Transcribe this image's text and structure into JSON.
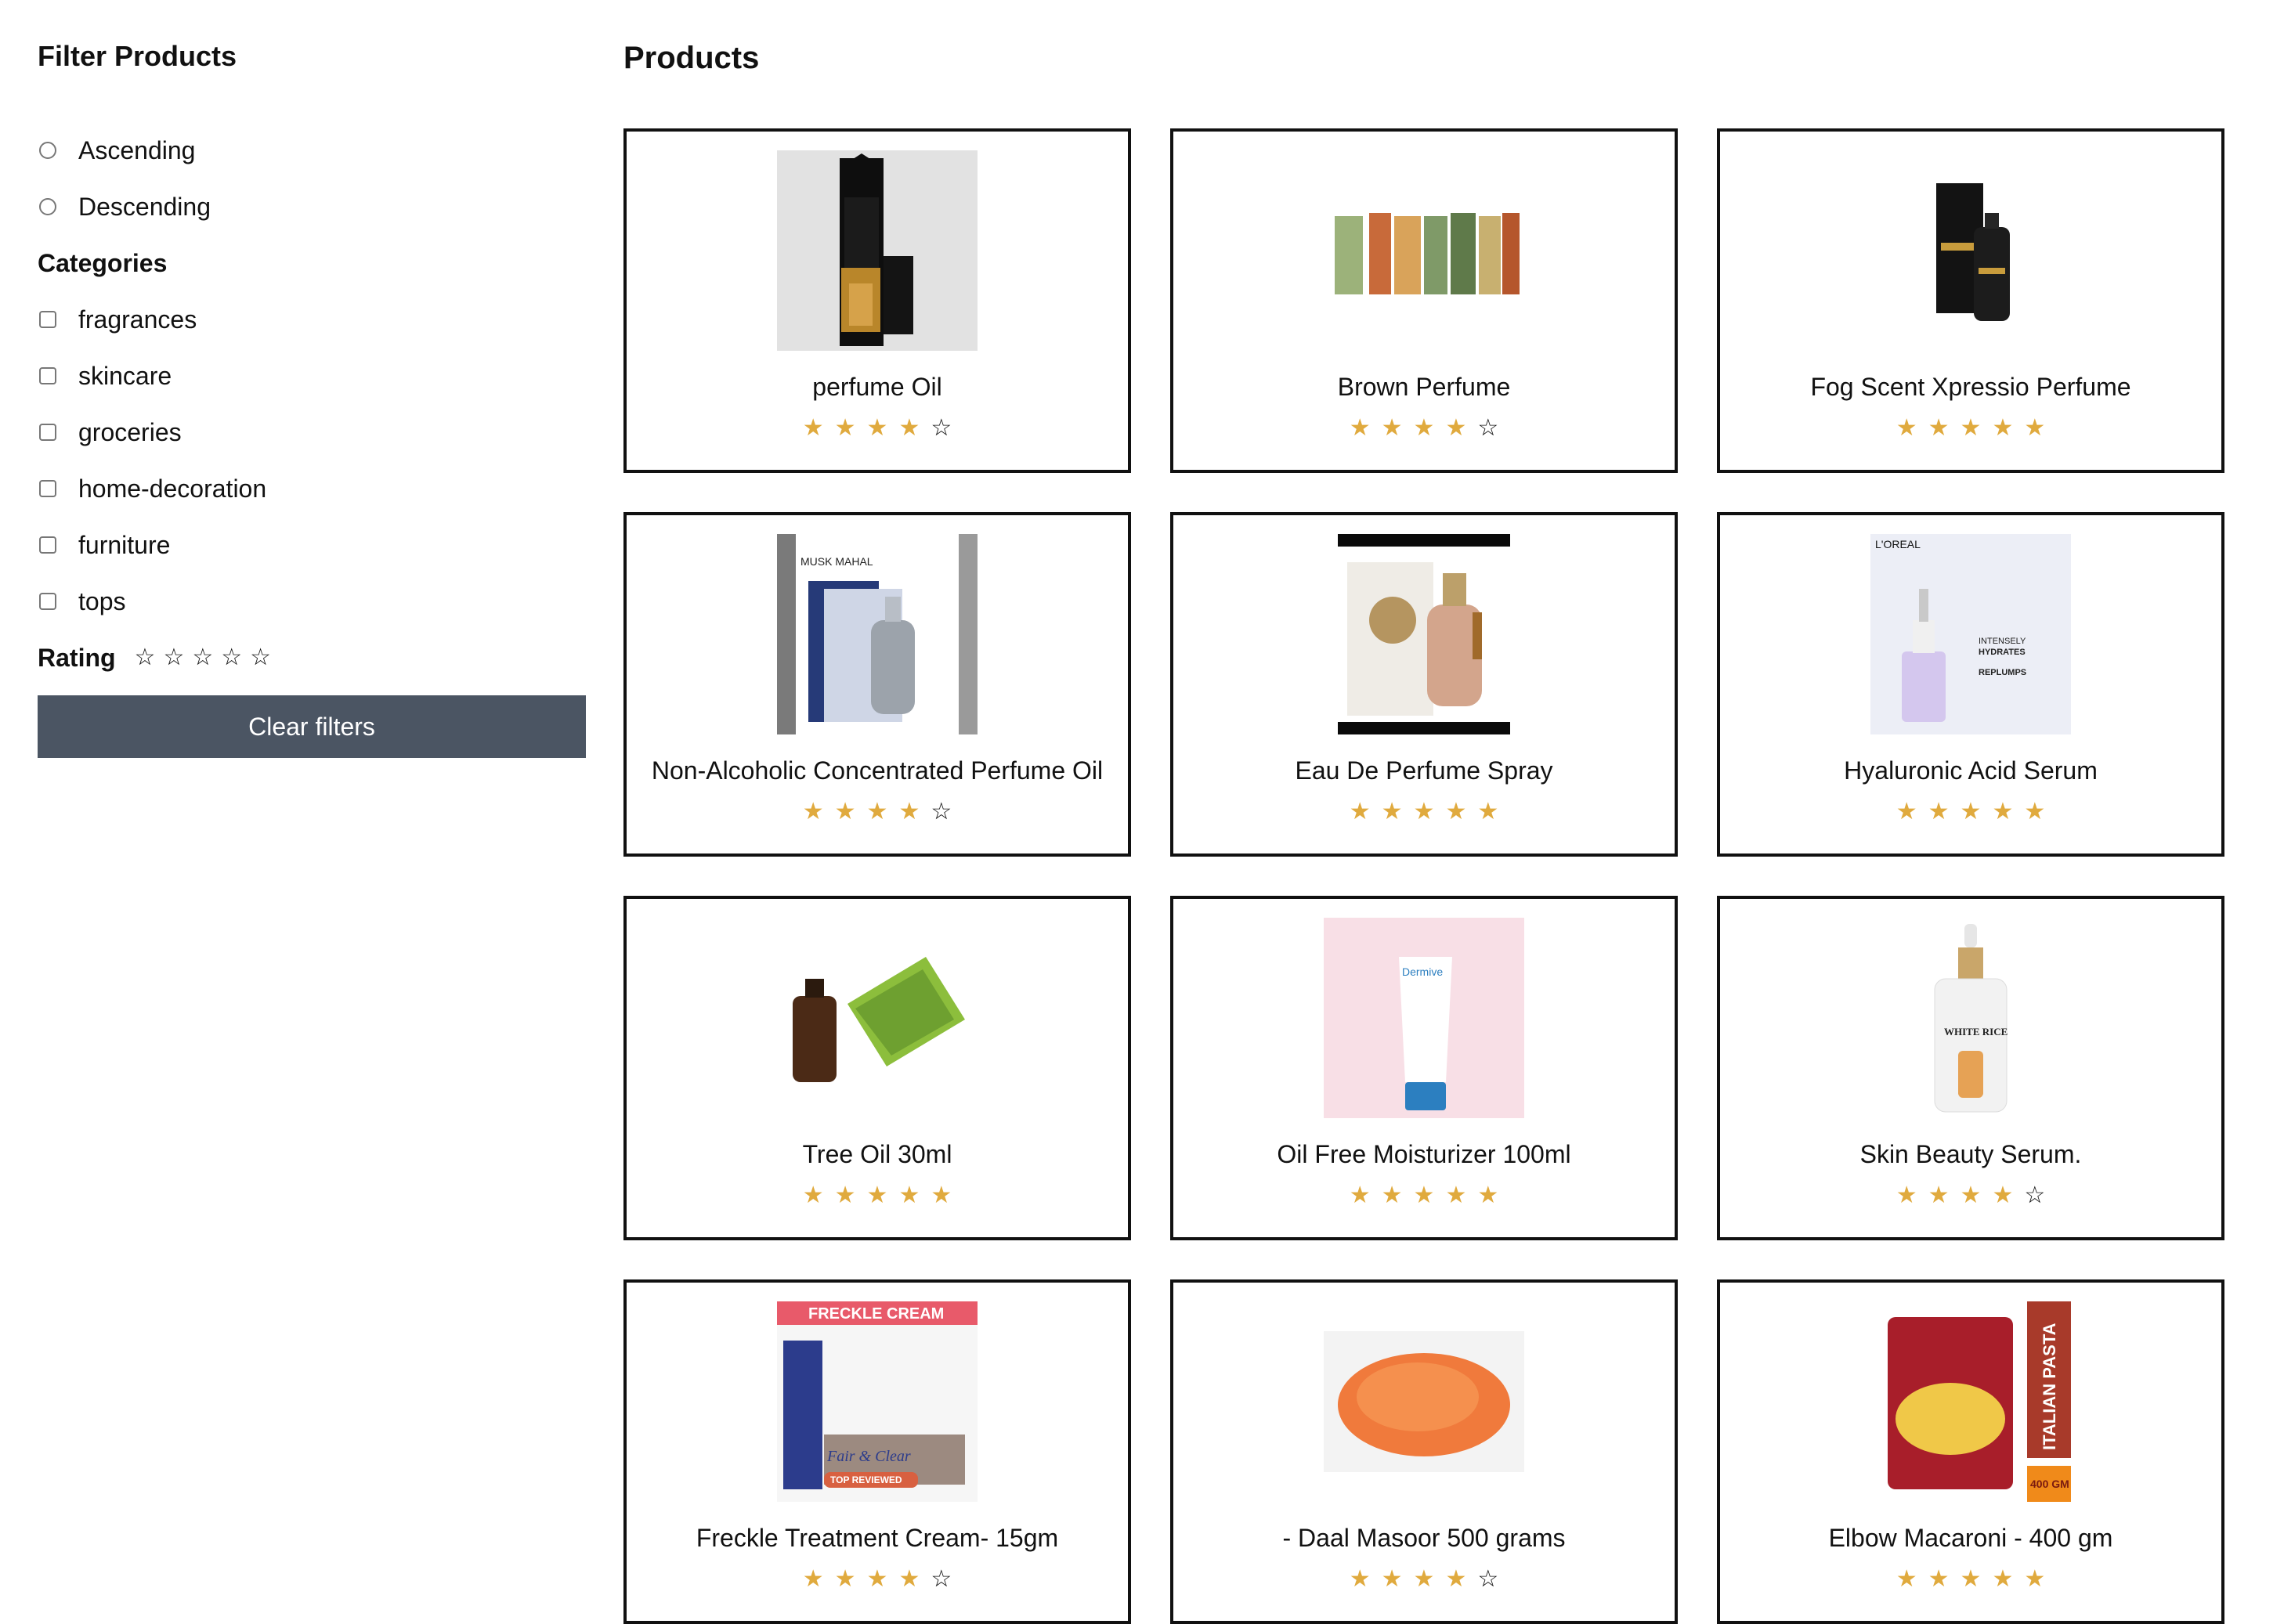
{
  "sidebar": {
    "title": "Filter Products",
    "sort_options": [
      {
        "label": "Ascending"
      },
      {
        "label": "Descending"
      }
    ],
    "categories_title": "Categories",
    "categories": [
      {
        "label": "fragrances"
      },
      {
        "label": "skincare"
      },
      {
        "label": "groceries"
      },
      {
        "label": "home-decoration"
      },
      {
        "label": "furniture"
      },
      {
        "label": "tops"
      }
    ],
    "rating_label": "Rating",
    "rating_stars": 5,
    "clear_label": "Clear filters"
  },
  "main": {
    "title": "Products",
    "products": [
      {
        "name": "perfume Oil",
        "rating": 4,
        "image": "perfume-gift-box"
      },
      {
        "name": "Brown Perfume",
        "rating": 4,
        "image": "perfume-bottles-row"
      },
      {
        "name": "Fog Scent Xpressio Perfume",
        "rating": 5,
        "image": "black-perfume-box"
      },
      {
        "name": "Non-Alcoholic Concentrated Perfume Oil",
        "rating": 4,
        "image": "attar-oil-box",
        "image_text": "MUSK MAHAL"
      },
      {
        "name": "Eau De Perfume Spray",
        "rating": 5,
        "image": "amber-perfume-bottle"
      },
      {
        "name": "Hyaluronic Acid Serum",
        "rating": 5,
        "image": "serum-dropper-box",
        "image_text": [
          "L'OREAL",
          "INTENSELY",
          "HYDRATES",
          "REPLUMPS"
        ]
      },
      {
        "name": "Tree Oil 30ml",
        "rating": 5,
        "image": "tea-tree-oil"
      },
      {
        "name": "Oil Free Moisturizer 100ml",
        "rating": 5,
        "image": "moisturizer-tube",
        "image_text": "Dermive"
      },
      {
        "name": "Skin Beauty Serum.",
        "rating": 4,
        "image": "white-serum-bottle",
        "image_text": "WHITE RICE"
      },
      {
        "name": "Freckle Treatment Cream- 15gm",
        "rating": 4,
        "image": "freckle-cream",
        "image_text": [
          "FRECKLE CREAM",
          "Fair & Clear",
          "TOP REVIEWED"
        ]
      },
      {
        "name": "- Daal Masoor 500 grams",
        "rating": 4,
        "image": "red-lentils"
      },
      {
        "name": "Elbow Macaroni - 400 gm",
        "rating": 5,
        "image": "macaroni-pack",
        "image_text": [
          "ITALIAN PASTA",
          "400 GM"
        ]
      }
    ]
  },
  "colors": {
    "star_filled": "#e0aa3e",
    "button_bg": "#4b5563",
    "card_border": "#111111"
  }
}
